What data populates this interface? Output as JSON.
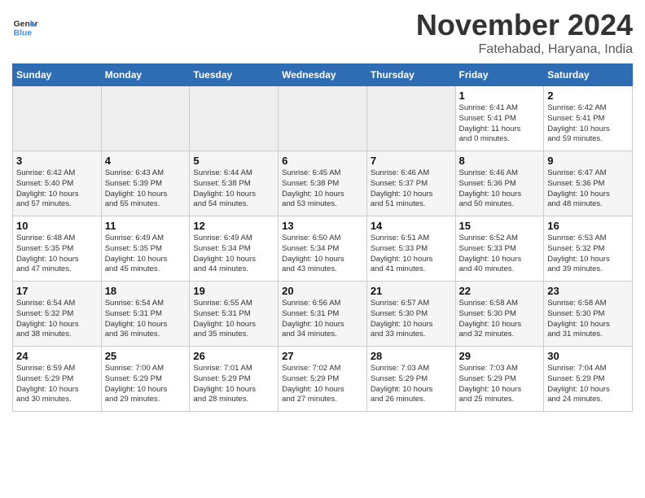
{
  "header": {
    "logo_line1": "General",
    "logo_line2": "Blue",
    "month": "November 2024",
    "location": "Fatehabad, Haryana, India"
  },
  "weekdays": [
    "Sunday",
    "Monday",
    "Tuesday",
    "Wednesday",
    "Thursday",
    "Friday",
    "Saturday"
  ],
  "weeks": [
    [
      {
        "day": "",
        "info": ""
      },
      {
        "day": "",
        "info": ""
      },
      {
        "day": "",
        "info": ""
      },
      {
        "day": "",
        "info": ""
      },
      {
        "day": "",
        "info": ""
      },
      {
        "day": "1",
        "info": "Sunrise: 6:41 AM\nSunset: 5:41 PM\nDaylight: 11 hours\nand 0 minutes."
      },
      {
        "day": "2",
        "info": "Sunrise: 6:42 AM\nSunset: 5:41 PM\nDaylight: 10 hours\nand 59 minutes."
      }
    ],
    [
      {
        "day": "3",
        "info": "Sunrise: 6:42 AM\nSunset: 5:40 PM\nDaylight: 10 hours\nand 57 minutes."
      },
      {
        "day": "4",
        "info": "Sunrise: 6:43 AM\nSunset: 5:39 PM\nDaylight: 10 hours\nand 55 minutes."
      },
      {
        "day": "5",
        "info": "Sunrise: 6:44 AM\nSunset: 5:38 PM\nDaylight: 10 hours\nand 54 minutes."
      },
      {
        "day": "6",
        "info": "Sunrise: 6:45 AM\nSunset: 5:38 PM\nDaylight: 10 hours\nand 53 minutes."
      },
      {
        "day": "7",
        "info": "Sunrise: 6:46 AM\nSunset: 5:37 PM\nDaylight: 10 hours\nand 51 minutes."
      },
      {
        "day": "8",
        "info": "Sunrise: 6:46 AM\nSunset: 5:36 PM\nDaylight: 10 hours\nand 50 minutes."
      },
      {
        "day": "9",
        "info": "Sunrise: 6:47 AM\nSunset: 5:36 PM\nDaylight: 10 hours\nand 48 minutes."
      }
    ],
    [
      {
        "day": "10",
        "info": "Sunrise: 6:48 AM\nSunset: 5:35 PM\nDaylight: 10 hours\nand 47 minutes."
      },
      {
        "day": "11",
        "info": "Sunrise: 6:49 AM\nSunset: 5:35 PM\nDaylight: 10 hours\nand 45 minutes."
      },
      {
        "day": "12",
        "info": "Sunrise: 6:49 AM\nSunset: 5:34 PM\nDaylight: 10 hours\nand 44 minutes."
      },
      {
        "day": "13",
        "info": "Sunrise: 6:50 AM\nSunset: 5:34 PM\nDaylight: 10 hours\nand 43 minutes."
      },
      {
        "day": "14",
        "info": "Sunrise: 6:51 AM\nSunset: 5:33 PM\nDaylight: 10 hours\nand 41 minutes."
      },
      {
        "day": "15",
        "info": "Sunrise: 6:52 AM\nSunset: 5:33 PM\nDaylight: 10 hours\nand 40 minutes."
      },
      {
        "day": "16",
        "info": "Sunrise: 6:53 AM\nSunset: 5:32 PM\nDaylight: 10 hours\nand 39 minutes."
      }
    ],
    [
      {
        "day": "17",
        "info": "Sunrise: 6:54 AM\nSunset: 5:32 PM\nDaylight: 10 hours\nand 38 minutes."
      },
      {
        "day": "18",
        "info": "Sunrise: 6:54 AM\nSunset: 5:31 PM\nDaylight: 10 hours\nand 36 minutes."
      },
      {
        "day": "19",
        "info": "Sunrise: 6:55 AM\nSunset: 5:31 PM\nDaylight: 10 hours\nand 35 minutes."
      },
      {
        "day": "20",
        "info": "Sunrise: 6:56 AM\nSunset: 5:31 PM\nDaylight: 10 hours\nand 34 minutes."
      },
      {
        "day": "21",
        "info": "Sunrise: 6:57 AM\nSunset: 5:30 PM\nDaylight: 10 hours\nand 33 minutes."
      },
      {
        "day": "22",
        "info": "Sunrise: 6:58 AM\nSunset: 5:30 PM\nDaylight: 10 hours\nand 32 minutes."
      },
      {
        "day": "23",
        "info": "Sunrise: 6:58 AM\nSunset: 5:30 PM\nDaylight: 10 hours\nand 31 minutes."
      }
    ],
    [
      {
        "day": "24",
        "info": "Sunrise: 6:59 AM\nSunset: 5:29 PM\nDaylight: 10 hours\nand 30 minutes."
      },
      {
        "day": "25",
        "info": "Sunrise: 7:00 AM\nSunset: 5:29 PM\nDaylight: 10 hours\nand 29 minutes."
      },
      {
        "day": "26",
        "info": "Sunrise: 7:01 AM\nSunset: 5:29 PM\nDaylight: 10 hours\nand 28 minutes."
      },
      {
        "day": "27",
        "info": "Sunrise: 7:02 AM\nSunset: 5:29 PM\nDaylight: 10 hours\nand 27 minutes."
      },
      {
        "day": "28",
        "info": "Sunrise: 7:03 AM\nSunset: 5:29 PM\nDaylight: 10 hours\nand 26 minutes."
      },
      {
        "day": "29",
        "info": "Sunrise: 7:03 AM\nSunset: 5:29 PM\nDaylight: 10 hours\nand 25 minutes."
      },
      {
        "day": "30",
        "info": "Sunrise: 7:04 AM\nSunset: 5:29 PM\nDaylight: 10 hours\nand 24 minutes."
      }
    ]
  ]
}
